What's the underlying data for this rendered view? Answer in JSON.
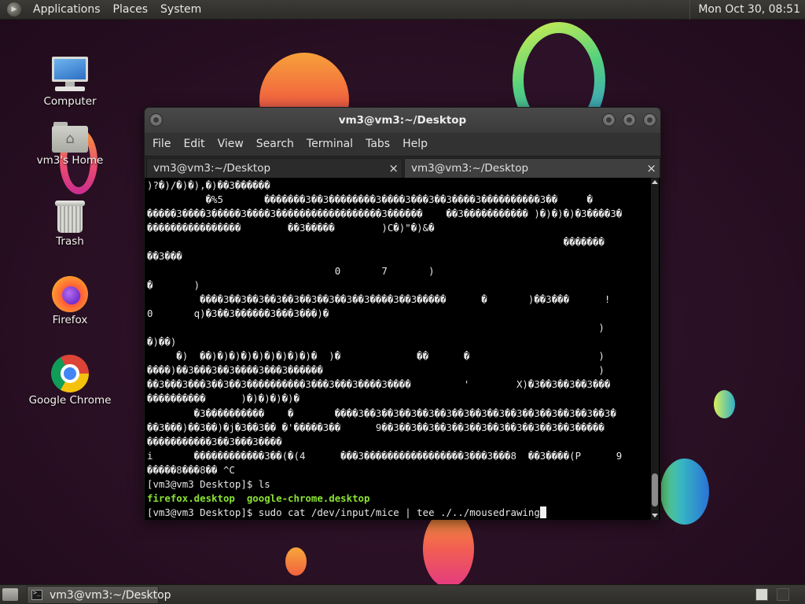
{
  "top_panel": {
    "menus": [
      "Applications",
      "Places",
      "System"
    ],
    "clock": "Mon Oct 30, 08:51"
  },
  "desktop_icons": [
    {
      "label": "Computer",
      "icon": "computer-icon"
    },
    {
      "label": "vm3's Home",
      "icon": "home-folder-icon"
    },
    {
      "label": "Trash",
      "icon": "trash-icon"
    },
    {
      "label": "Firefox",
      "icon": "firefox-icon"
    },
    {
      "label": "Google Chrome",
      "icon": "chrome-icon"
    }
  ],
  "window": {
    "title": "vm3@vm3:~/Desktop",
    "menu": [
      "File",
      "Edit",
      "View",
      "Search",
      "Terminal",
      "Tabs",
      "Help"
    ],
    "tabs": [
      {
        "label": "vm3@vm3:~/Desktop",
        "close": "×"
      },
      {
        "label": "vm3@vm3:~/Desktop",
        "close": "×"
      }
    ]
  },
  "terminal": {
    "lines": [
      ")?�)/�)�),�)��3������",
      "          �%5       �������3��3��������3����3���3��3����3����������3��     �",
      "�����3����3�����3����3������������������3������    ��3����������� )�)�)�)�3����3�",
      "����������������        ��3�����        )C�)\"�)&�",
      "                                                                       �������",
      "��3���",
      "                                0       7       )",
      "�       )",
      "         ����3��3��3��3��3��3��3��3��3����3��3�����      �       )��3���      !",
      "0       q)�3��3������3���3���)�",
      "                                                                             )",
      "�)��)",
      "     �)  ��)�)�)�)�)�)�)�)�)�  )�             ��      �                      )",
      "����)��3���3��3����3���3������                                               )",
      "��3���3���3��3��3����������3���3���3����3����         '        X)�3��3��3��3���",
      "����������      )�)�)�)�)�",
      "        �3����������    �       ����3��3��3��3��3��3��3��3��3��3��3��3��3��3��3�",
      "��3���)��3��)�j�3��3�� �'�����3��      9��3��3��3��3��3��3��3��3��3��3��3�����",
      "�����������3��3���3����",
      "i       ������������3��(�(4      ���3�����������������3���3���8  ��3����(P      9",
      "�����8���8�� ^C",
      "[vm3@vm3 Desktop]$ ls"
    ],
    "ls_output": "firefox.desktop  google-chrome.desktop",
    "prompt_line": "[vm3@vm3 Desktop]$ sudo cat /dev/input/mice | tee ./../mousedrawing"
  },
  "bottom_panel": {
    "taskbar_label": "vm3@vm3:~/Desktop"
  }
}
